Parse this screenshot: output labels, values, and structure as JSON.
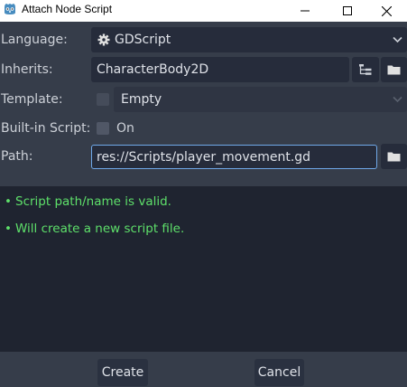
{
  "window": {
    "title": "Attach Node Script",
    "controls": [
      "minimize-icon",
      "maximize-icon",
      "close-icon"
    ]
  },
  "form": {
    "language": {
      "label": "Language:",
      "value": "GDScript",
      "icon": "gear-icon"
    },
    "inherits": {
      "label": "Inherits:",
      "value": "CharacterBody2D"
    },
    "template": {
      "label": "Template:",
      "value": "Empty",
      "checked": false,
      "enabled": false
    },
    "builtin": {
      "label": "Built-in Script:",
      "option_label": "On",
      "checked": false
    },
    "path": {
      "label": "Path:",
      "value": "res://Scripts/player_movement.gd"
    }
  },
  "messages": [
    {
      "bullet": "•",
      "text": "Script path/name is valid."
    },
    {
      "bullet": "•",
      "text": "Will create a new script file."
    }
  ],
  "buttons": {
    "create": "Create",
    "cancel": "Cancel"
  },
  "colors": {
    "background": "#363d4a",
    "field": "#262c3b",
    "panel": "#1f2430",
    "success": "#5ee06a",
    "focus_border": "#6fa8e8"
  }
}
